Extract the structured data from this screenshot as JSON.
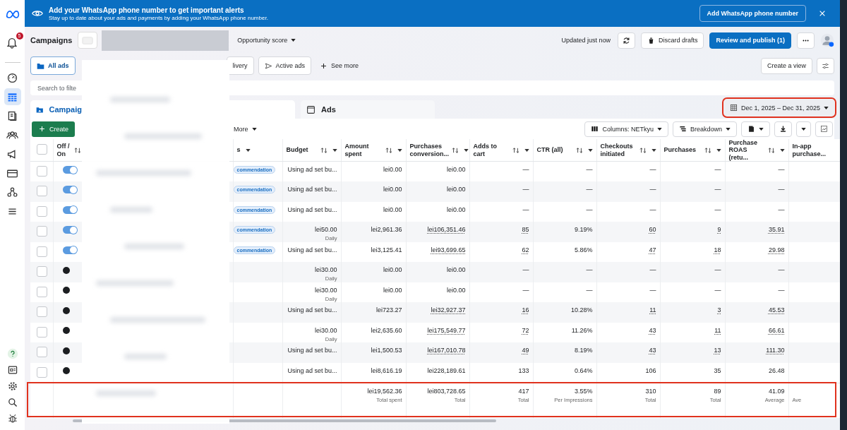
{
  "banner": {
    "title": "Add your WhatsApp phone number to get important alerts",
    "subtitle": "Stay up to date about your ads and payments by adding your WhatsApp phone number.",
    "button": "Add WhatsApp phone number"
  },
  "sidebar": {
    "notification_count": "5",
    "items": [
      {
        "selected": false
      },
      {
        "selected": true
      },
      {
        "selected": false
      },
      {
        "selected": false
      },
      {
        "selected": false
      },
      {
        "selected": false
      },
      {
        "selected": false
      },
      {
        "selected": false
      }
    ]
  },
  "header": {
    "title": "Campaigns",
    "opportunity": "Opportunity score",
    "updated": "Updated just now",
    "discard": "Discard drafts",
    "publish": "Review and publish (1)"
  },
  "view_tabs": [
    {
      "label": "All ads",
      "selected": true
    },
    {
      "label": "livery",
      "selected": false
    },
    {
      "label": "Active ads",
      "selected": false
    }
  ],
  "see_more": "See more",
  "create_view": "Create a view",
  "search": {
    "placeholder": "Search to filte"
  },
  "level_tabs": [
    {
      "label": "Campaig",
      "selected": true
    },
    {
      "label": "Ads",
      "selected": false
    }
  ],
  "date_range": "Dec 1, 2025 – Dec 31, 2025",
  "toolbar": {
    "create": "Create",
    "more": "More",
    "columns": "Columns: NETkyu",
    "breakdown": "Breakdown"
  },
  "table": {
    "columns": [
      "Off / On",
      "",
      "s",
      "Budget",
      "Amount spent",
      "Purchases conversion...",
      "Adds to cart",
      "CTR (all)",
      "Checkouts initiated",
      "Purchases",
      "Purchase ROAS (retu...",
      "In-app purchase..."
    ],
    "rows": [
      {
        "checked": false,
        "on": true,
        "badge": "commendation",
        "budget": "Using ad set bu...",
        "budget_note": "",
        "spent": "lei0.00",
        "conversion": "lei0.00",
        "adds": "—",
        "ctr": "—",
        "checkouts": "—",
        "purchases": "—",
        "roas": "—",
        "linked": false
      },
      {
        "checked": false,
        "on": true,
        "badge": "commendation",
        "budget": "Using ad set bu...",
        "budget_note": "",
        "spent": "lei0.00",
        "conversion": "lei0.00",
        "adds": "—",
        "ctr": "—",
        "checkouts": "—",
        "purchases": "—",
        "roas": "—",
        "linked": false
      },
      {
        "checked": false,
        "on": true,
        "badge": "commendation",
        "budget": "Using ad set bu...",
        "budget_note": "",
        "spent": "lei0.00",
        "conversion": "lei0.00",
        "adds": "—",
        "ctr": "—",
        "checkouts": "—",
        "purchases": "—",
        "roas": "—",
        "linked": false
      },
      {
        "checked": false,
        "on": true,
        "badge": "commendation",
        "budget": "lei50.00",
        "budget_note": "Daily",
        "spent": "lei2,961.36",
        "conversion": "lei106,351.46",
        "adds": "85",
        "ctr": "9.19%",
        "checkouts": "60",
        "purchases": "9",
        "roas": "35.91",
        "linked": true
      },
      {
        "checked": false,
        "on": true,
        "badge": "commendation",
        "budget": "Using ad set bu...",
        "budget_note": "",
        "spent": "lei3,125.41",
        "conversion": "lei93,699.65",
        "adds": "62",
        "ctr": "5.86%",
        "checkouts": "47",
        "purchases": "18",
        "roas": "29.98",
        "linked": true
      },
      {
        "checked": false,
        "on": false,
        "badge": "",
        "budget": "lei30.00",
        "budget_note": "Daily",
        "spent": "lei0.00",
        "conversion": "lei0.00",
        "adds": "—",
        "ctr": "—",
        "checkouts": "—",
        "purchases": "—",
        "roas": "—",
        "linked": false
      },
      {
        "checked": false,
        "on": false,
        "badge": "",
        "budget": "lei30.00",
        "budget_note": "Daily",
        "spent": "lei0.00",
        "conversion": "lei0.00",
        "adds": "—",
        "ctr": "—",
        "checkouts": "—",
        "purchases": "—",
        "roas": "—",
        "linked": false
      },
      {
        "checked": false,
        "on": false,
        "badge": "",
        "budget": "Using ad set bu...",
        "budget_note": "",
        "spent": "lei723.27",
        "conversion": "lei32,927.37",
        "adds": "16",
        "ctr": "10.28%",
        "checkouts": "11",
        "purchases": "3",
        "roas": "45.53",
        "linked": true
      },
      {
        "checked": false,
        "on": false,
        "badge": "",
        "budget": "lei30.00",
        "budget_note": "Daily",
        "spent": "lei2,635.60",
        "conversion": "lei175,549.77",
        "adds": "72",
        "ctr": "11.26%",
        "checkouts": "43",
        "purchases": "11",
        "roas": "66.61",
        "linked": true
      },
      {
        "checked": false,
        "on": false,
        "badge": "",
        "budget": "Using ad set bu...",
        "budget_note": "",
        "spent": "lei1,500.53",
        "conversion": "lei167,010.78",
        "adds": "49",
        "ctr": "8.19%",
        "checkouts": "43",
        "purchases": "13",
        "roas": "111.30",
        "linked": true
      },
      {
        "checked": false,
        "on": false,
        "badge": "",
        "budget": "Using ad set bu...",
        "budget_note": "",
        "spent": "lei8,616.19",
        "conversion": "lei228,189.61",
        "adds": "133",
        "ctr": "0.64%",
        "checkouts": "106",
        "purchases": "35",
        "roas": "26.48",
        "linked": false
      }
    ],
    "totals": [
      {
        "value": "lei19,562.36",
        "label": "Total spent"
      },
      {
        "value": "lei803,728.65",
        "label": "Total"
      },
      {
        "value": "417",
        "label": "Total"
      },
      {
        "value": "3.55%",
        "label": "Per Impressions"
      },
      {
        "value": "310",
        "label": "Total"
      },
      {
        "value": "89",
        "label": "Total"
      },
      {
        "value": "41.09",
        "label": "Average"
      },
      {
        "label": "Ave"
      }
    ]
  },
  "select_all_checked": false
}
